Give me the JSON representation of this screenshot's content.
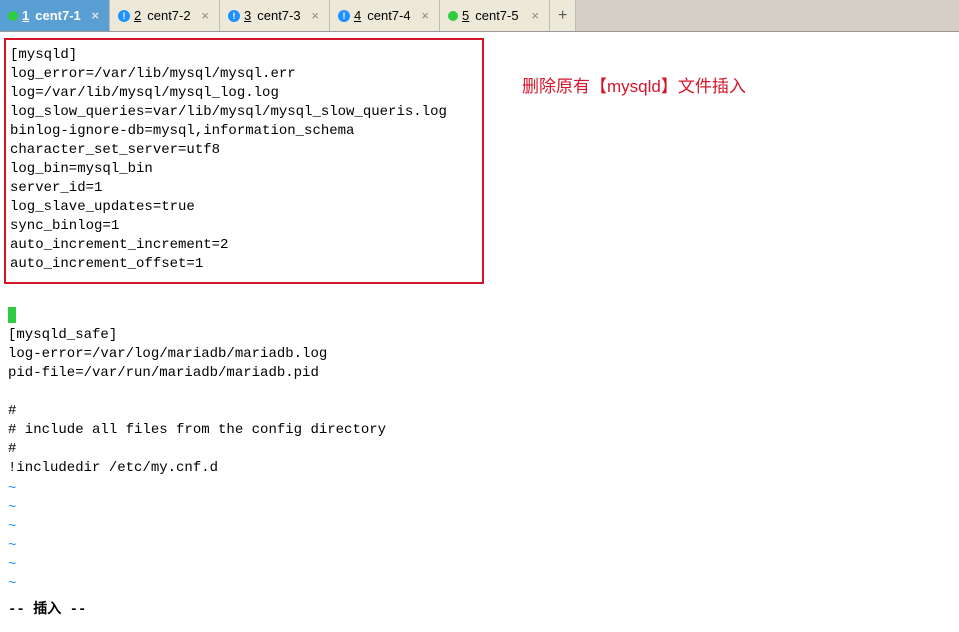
{
  "tabs": [
    {
      "num": "1",
      "label": "cent7-1",
      "icon": "green-dot",
      "active": true
    },
    {
      "num": "2",
      "label": "cent7-2",
      "icon": "info",
      "active": false
    },
    {
      "num": "3",
      "label": "cent7-3",
      "icon": "info",
      "active": false
    },
    {
      "num": "4",
      "label": "cent7-4",
      "icon": "info",
      "active": false
    },
    {
      "num": "5",
      "label": "cent7-5",
      "icon": "green-dot",
      "active": false
    }
  ],
  "add_tab": "+",
  "close_glyph": "×",
  "annotation": "删除原有【mysqld】文件插入",
  "config_block": "[mysqld]\nlog_error=/var/lib/mysql/mysql.err\nlog=/var/lib/mysql/mysql_log.log\nlog_slow_queries=var/lib/mysql/mysql_slow_queris.log\nbinlog-ignore-db=mysql,information_schema\ncharacter_set_server=utf8\nlog_bin=mysql_bin\nserver_id=1\nlog_slave_updates=true\nsync_binlog=1\nauto_increment_increment=2\nauto_increment_offset=1",
  "after_block": "[mysqld_safe]\nlog-error=/var/log/mariadb/mariadb.log\npid-file=/var/run/mariadb/mariadb.pid\n\n#\n# include all files from the config directory\n#\n!includedir /etc/my.cnf.d\n",
  "tilde": "~",
  "tilde_count": 6,
  "status": "-- 插入 --"
}
